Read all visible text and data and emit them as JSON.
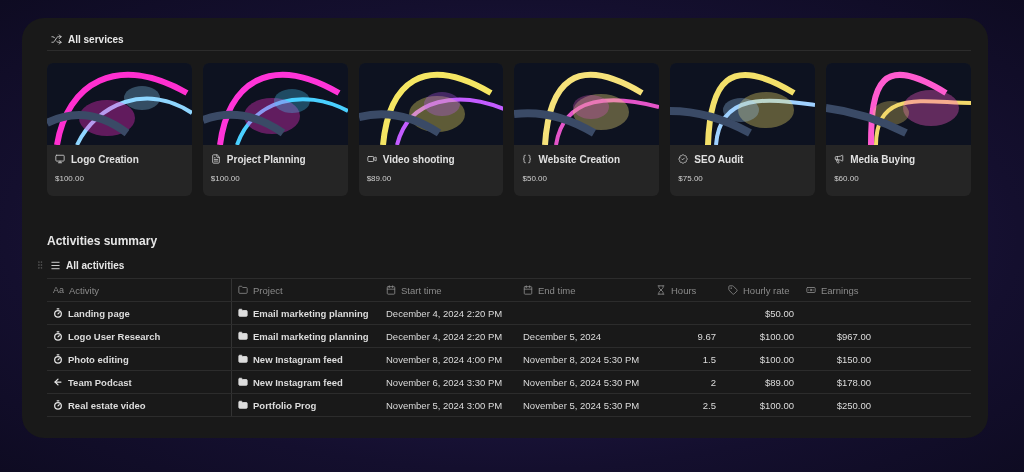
{
  "services": {
    "title": "All services",
    "cards": [
      {
        "name": "Logo Creation",
        "price": "$100.00"
      },
      {
        "name": "Project Planning",
        "price": "$100.00"
      },
      {
        "name": "Video shooting",
        "price": "$89.00"
      },
      {
        "name": "Website Creation",
        "price": "$50.00"
      },
      {
        "name": "SEO Audit",
        "price": "$75.00"
      },
      {
        "name": "Media Buying",
        "price": "$60.00"
      }
    ]
  },
  "activities": {
    "title": "Activities summary",
    "view": "All activities",
    "columns": [
      {
        "label": "Activity",
        "glyph": "Aa"
      },
      {
        "label": "Project"
      },
      {
        "label": "Start time"
      },
      {
        "label": "End time"
      },
      {
        "label": "Hours"
      },
      {
        "label": "Hourly rate"
      },
      {
        "label": "Earnings"
      }
    ],
    "rows": [
      {
        "kind": "timer",
        "activity": "Landing page",
        "project": "Email marketing planning",
        "start": "December 4, 2024 2:20 PM",
        "end": "",
        "hours": "",
        "rate": "$50.00",
        "earnings": ""
      },
      {
        "kind": "timer",
        "activity": "Logo User Research",
        "project": "Email marketing planning",
        "start": "December 4, 2024 2:20 PM",
        "end": "December 5, 2024",
        "hours": "9.67",
        "rate": "$100.00",
        "earnings": "$967.00"
      },
      {
        "kind": "timer",
        "activity": "Photo editing",
        "project": "New Instagram feed",
        "start": "November 8, 2024 4:00 PM",
        "end": "November 8, 2024 5:30 PM",
        "hours": "1.5",
        "rate": "$100.00",
        "earnings": "$150.00"
      },
      {
        "kind": "back",
        "activity": "Team Podcast",
        "project": "New Instagram feed",
        "start": "November 6, 2024 3:30 PM",
        "end": "November 6, 2024 5:30 PM",
        "hours": "2",
        "rate": "$89.00",
        "earnings": "$178.00"
      },
      {
        "kind": "timer",
        "activity": "Real estate video",
        "project": "Portfolio Prog",
        "start": "November 5, 2024 3:00 PM",
        "end": "November 5, 2024 5:30 PM",
        "hours": "2.5",
        "rate": "$100.00",
        "earnings": "$250.00"
      }
    ]
  }
}
